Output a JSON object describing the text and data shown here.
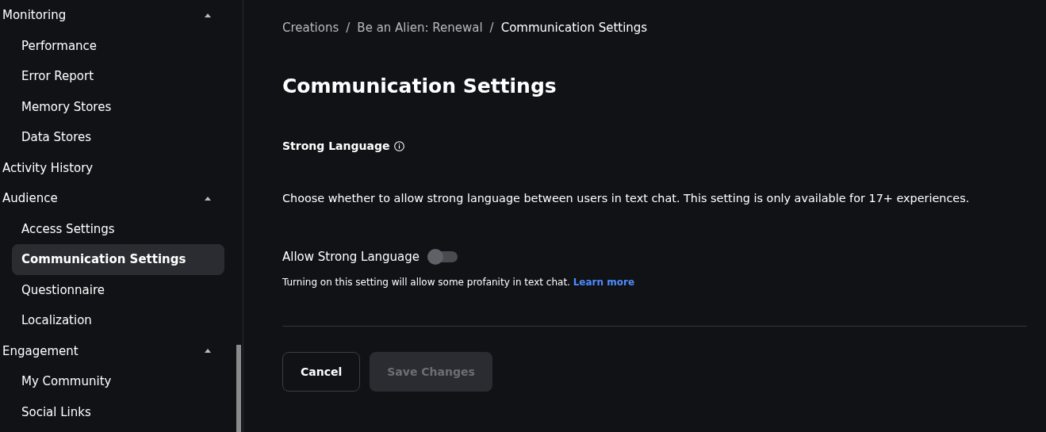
{
  "sidebar": {
    "items": [
      {
        "label": "Monitoring",
        "expanded": true,
        "children": [
          {
            "label": "Performance",
            "selected": false
          },
          {
            "label": "Error Report",
            "selected": false
          },
          {
            "label": "Memory Stores",
            "selected": false
          },
          {
            "label": "Data Stores",
            "selected": false
          }
        ]
      },
      {
        "label": "Activity History",
        "selected": false
      },
      {
        "label": "Audience",
        "expanded": true,
        "children": [
          {
            "label": "Access Settings",
            "selected": false
          },
          {
            "label": "Communication Settings",
            "selected": true
          },
          {
            "label": "Questionnaire",
            "selected": false
          },
          {
            "label": "Localization",
            "selected": false
          }
        ]
      },
      {
        "label": "Engagement",
        "expanded": true,
        "children": [
          {
            "label": "My Community",
            "selected": false
          },
          {
            "label": "Social Links",
            "selected": false
          }
        ]
      }
    ]
  },
  "breadcrumb": [
    "Creations",
    "Be an Alien: Renewal",
    "Communication Settings"
  ],
  "breadcrumb_separator": "/",
  "title": "Communication Settings",
  "section": {
    "heading": "Strong Language",
    "description": "Choose whether to allow strong language between users in text chat. This setting is only available for 17+ experiences."
  },
  "toggle": {
    "label": "Allow Strong Language",
    "on": false
  },
  "hint": {
    "text": "Turning on this setting will allow some profanity in text chat.",
    "link": "Learn more"
  },
  "buttons": [
    {
      "label": "Cancel",
      "kind": "outline",
      "disabled": false
    },
    {
      "label": "Save Changes",
      "kind": "filled",
      "disabled": true
    }
  ]
}
